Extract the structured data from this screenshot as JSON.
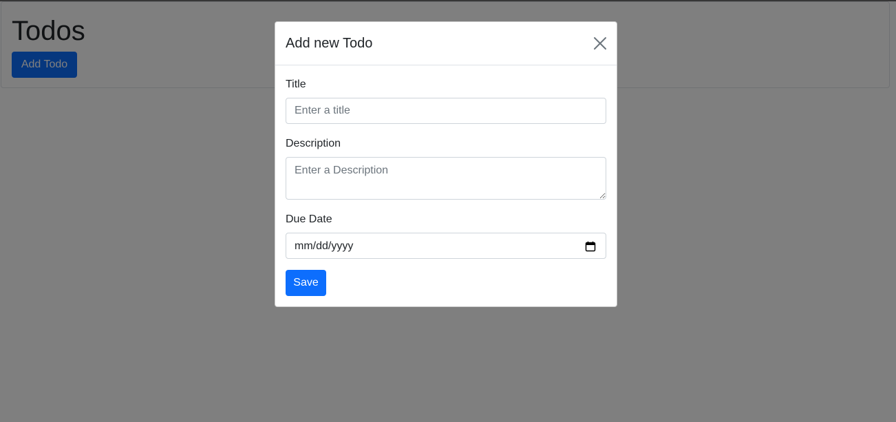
{
  "page": {
    "title": "Todos",
    "add_button_label": "Add Todo"
  },
  "modal": {
    "title": "Add new Todo",
    "close_icon": "close-icon",
    "fields": {
      "title": {
        "label": "Title",
        "placeholder": "Enter a title",
        "value": ""
      },
      "description": {
        "label": "Description",
        "placeholder": "Enter a Description",
        "value": ""
      },
      "due_date": {
        "label": "Due Date",
        "display": "mm/dd/yyyy",
        "icon": "calendar-icon"
      }
    },
    "save_label": "Save"
  },
  "colors": {
    "primary": "#0d6efd",
    "backdrop": "rgba(0,0,0,0.5)",
    "border": "#ced4da"
  }
}
